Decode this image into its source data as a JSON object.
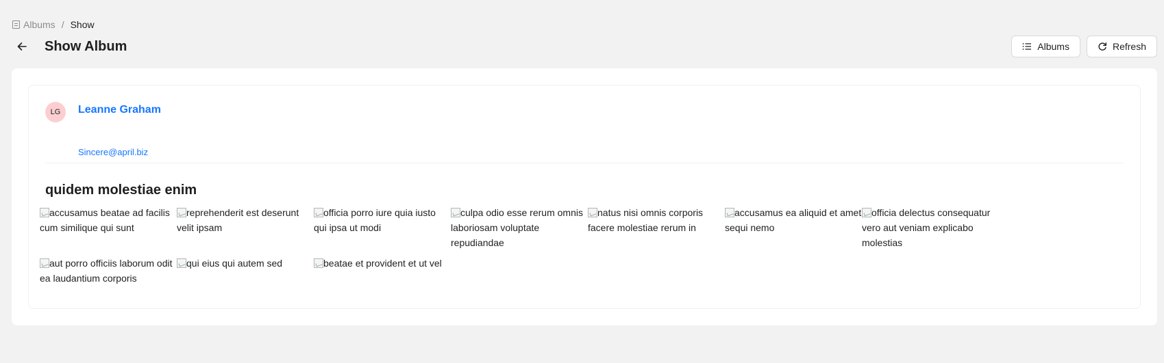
{
  "breadcrumb": {
    "items": [
      {
        "label": "Albums",
        "icon": "list-icon"
      },
      {
        "label": "Show"
      }
    ],
    "separator": "/"
  },
  "header": {
    "title": "Show Album",
    "back_icon": "arrow-left-icon",
    "actions": [
      {
        "label": "Albums",
        "icon": "list-icon"
      },
      {
        "label": "Refresh",
        "icon": "refresh-icon"
      }
    ]
  },
  "author": {
    "initials": "LG",
    "name": "Leanne Graham",
    "email": "Sincere@april.biz",
    "avatar_color": "#fbcfd1"
  },
  "album": {
    "title": "quidem molestiae enim",
    "photos": [
      {
        "alt": "accusamus beatae ad facilis cum similique qui sunt"
      },
      {
        "alt": "reprehenderit est deserunt velit ipsam"
      },
      {
        "alt": "officia porro iure quia iusto qui ipsa ut modi"
      },
      {
        "alt": "culpa odio esse rerum omnis laboriosam voluptate repudiandae"
      },
      {
        "alt": "natus nisi omnis corporis facere molestiae rerum in"
      },
      {
        "alt": "accusamus ea aliquid et amet sequi nemo"
      },
      {
        "alt": "officia delectus consequatur vero aut veniam explicabo molestias"
      },
      {
        "alt": "aut porro officiis laborum odit ea laudantium corporis"
      },
      {
        "alt": "qui eius qui autem sed"
      },
      {
        "alt": "beatae et provident et ut vel"
      }
    ]
  },
  "colors": {
    "accent": "#1677ff",
    "background": "#f2f2f2"
  }
}
